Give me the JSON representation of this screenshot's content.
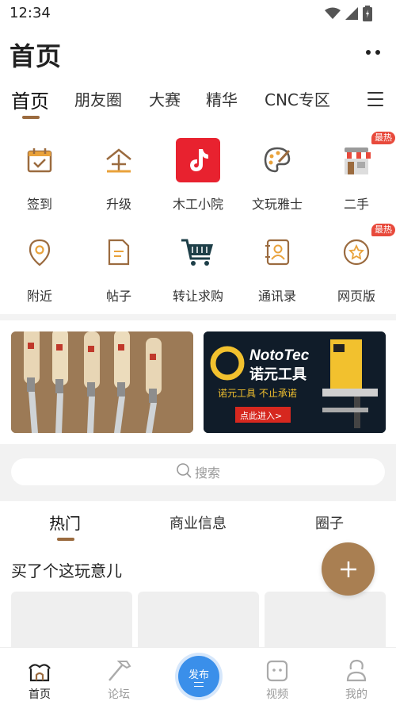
{
  "status_bar": {
    "time": "12:34",
    "icons": [
      "wifi-icon",
      "signal-icon",
      "battery-icon"
    ]
  },
  "header": {
    "title": "首页",
    "more_icon": "more-dots-icon"
  },
  "top_tabs": [
    "首页",
    "朋友圈",
    "大赛",
    "精华",
    "CNC专区"
  ],
  "top_tabs_active": "首页",
  "grid": {
    "row1": [
      {
        "label": "签到",
        "icon": "calendar-check-icon"
      },
      {
        "label": "升级",
        "icon": "upgrade-icon"
      },
      {
        "label": "木工小院",
        "icon": "tiktok-icon"
      },
      {
        "label": "文玩雅士",
        "icon": "palette-icon"
      },
      {
        "label": "二手",
        "icon": "shop-icon",
        "badge": "最热"
      }
    ],
    "row2": [
      {
        "label": "附近",
        "icon": "location-pin-icon"
      },
      {
        "label": "帖子",
        "icon": "document-icon"
      },
      {
        "label": "转让求购",
        "icon": "shopping-cart-icon"
      },
      {
        "label": "通讯录",
        "icon": "contacts-icon"
      },
      {
        "label": "网页版",
        "icon": "star-circle-icon",
        "badge": "最热"
      }
    ]
  },
  "banners": {
    "left": {
      "description_icon": "carving-tools-image"
    },
    "right": {
      "brand": "NotoTec",
      "brand_cn": "诺元工具",
      "slogan": "诺元工具 不止承诺",
      "cta": "点此进入>"
    }
  },
  "search": {
    "placeholder": "搜索"
  },
  "sub_tabs": [
    "热门",
    "商业信息",
    "圈子"
  ],
  "sub_tabs_active": "热门",
  "section_title": "买了个这玩意儿",
  "bottom_nav": [
    {
      "label": "首页",
      "icon": "home-icon",
      "active": true
    },
    {
      "label": "论坛",
      "icon": "hammer-icon",
      "active": false
    },
    {
      "label": "发布",
      "icon": "publish-icon",
      "active": false
    },
    {
      "label": "视频",
      "icon": "video-icon",
      "active": false
    },
    {
      "label": "我的",
      "icon": "profile-icon",
      "active": false
    }
  ],
  "colors": {
    "accent": "#9b6b3f",
    "fab": "#a97f52",
    "publish": "#3a8fea",
    "badge": "#e84a3c",
    "tiktok_red": "#e8222f"
  }
}
